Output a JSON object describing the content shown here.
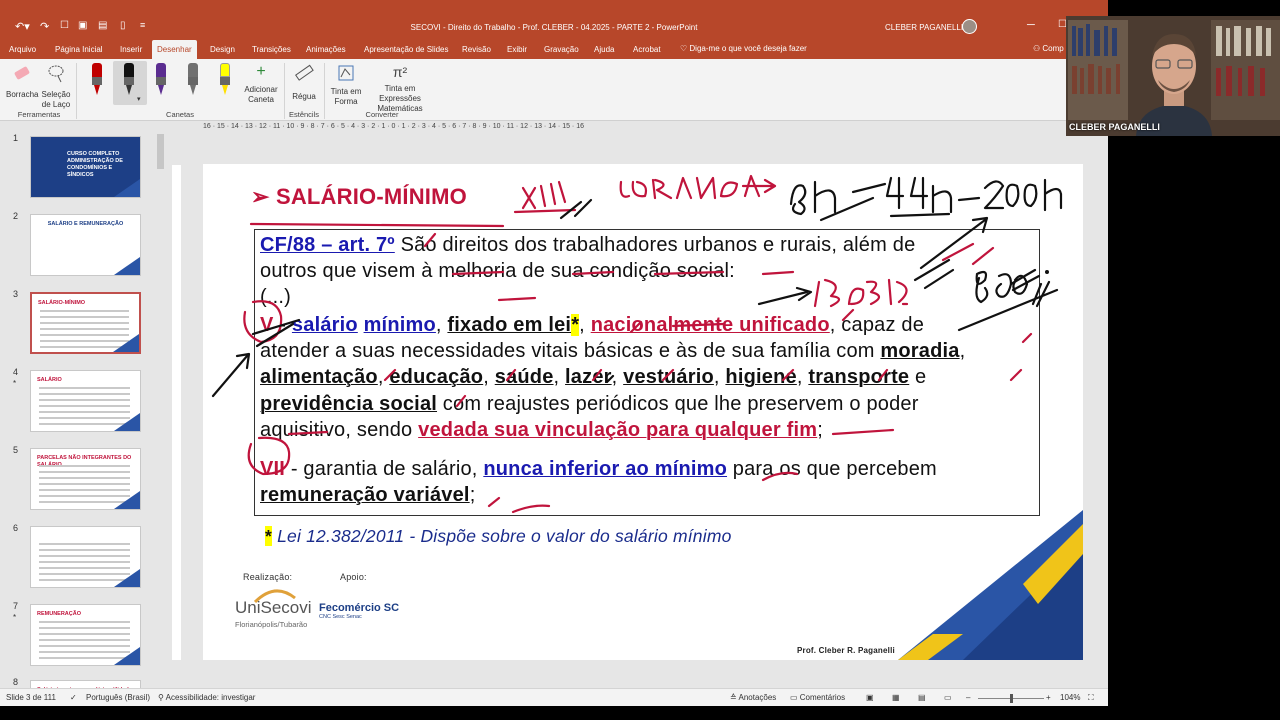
{
  "window": {
    "title": "SECOVI - Direito do Trabalho - Prof. CLEBER - 04.2025 - PARTE 2 - PowerPoint",
    "user": "CLEBER PAGANELLI"
  },
  "tabs": [
    "Arquivo",
    "Página Inicial",
    "Inserir",
    "Desenhar",
    "Design",
    "Transições",
    "Animações",
    "Apresentação de Slides",
    "Revisão",
    "Exibir",
    "Gravação",
    "Ajuda",
    "Acrobat"
  ],
  "active_tab": "Desenhar",
  "tell_me": "Diga-me o que você deseja fazer",
  "share": "Comp",
  "ribbon": {
    "eraser": "Borracha",
    "lasso": "Seleção de Laço",
    "add_pen": "Adicionar Caneta",
    "ruler": "Régua",
    "ink_to_shape": "Tinta em Forma",
    "ink_to_math": "Tinta em Expressões Matemáticas",
    "groups": {
      "tools": "Ferramentas",
      "pens": "Canetas",
      "stencils": "Estêncils",
      "convert": "Converter"
    },
    "pen_colors": [
      "#c00000",
      "#111111",
      "#5b2d90",
      "#707070",
      "#ffff00"
    ]
  },
  "thumbnails": [
    {
      "num": "1",
      "star": "",
      "title": "CURSO COMPLETO ADMINISTRAÇÃO DE CONDOMÍNIOS E SÍNDICOS"
    },
    {
      "num": "2",
      "star": "",
      "title": "SALÁRIO E REMUNERAÇÃO"
    },
    {
      "num": "3",
      "star": "",
      "title": "SALÁRIO-MÍNIMO"
    },
    {
      "num": "4",
      "star": "*",
      "title": "SALÁRIO"
    },
    {
      "num": "5",
      "star": "",
      "title": "PARCELAS NÃO INTEGRANTES DO SALÁRIO"
    },
    {
      "num": "6",
      "star": "",
      "title": ""
    },
    {
      "num": "7",
      "star": "*",
      "title": "REMUNERAÇÃO"
    },
    {
      "num": "8",
      "star": "",
      "title": "Salário in natura ou salário utilidade"
    }
  ],
  "ruler_labels": "16 · 15 · 14 · 13 · 12 · 11 · 10 · 9 · 8 · 7 · 6 · 5 · 4 · 3 · 2 · 1 · 0 · 1 · 2 · 3 · 4 · 5 · 6 · 7 · 8 · 9 · 10 · 11 · 12 · 13 · 14 · 15 · 16",
  "slide": {
    "heading_arrow": "➢",
    "heading": "SALÁRIO-MÍNIMO",
    "cf_ref": "CF/88 – art. 7º",
    "intro_1": " São direitos dos trabalhadores urbanos e rurais, além de",
    "intro_2": "outros que visem à melhoria de sua condição social:",
    "ellipsis": "(...)",
    "v_numeral": "V",
    "v_dash": " - ",
    "v_salario": "salário",
    "v_minimo": "mínimo",
    "v_fixado": "fixado em lei",
    "v_asterisk": "*",
    "v_nacional": "nacionalmente unificado",
    "v_capaz": ", capaz de",
    "line_atender": "atender a suas necessidades vitais básicas e às de sua família com",
    "moradia": "moradia",
    "alimentacao": "alimentação",
    "educacao": "educação",
    "saude": "saúde",
    "lazer": "lazer",
    "vestuario": "vestuário",
    "higiene": "higiene",
    "transporte": "transporte",
    "e": "e",
    "previdencia": "previdência social",
    "com_reajustes": "com reajustes periódicos que lhe preservem o poder",
    "aquisitivo": "aquisitivo, sendo",
    "vedada": "vedada sua vinculação para qualquer fim",
    "semicolon": ";",
    "vii_numeral": "VII",
    "vii_text": " - garantia de salário,",
    "vii_nunca": "nunca inferior ao mínimo",
    "vii_rest": " para os que percebem",
    "remuneracao": "remuneração variável",
    "footnote_star": "*",
    "footnote": " Lei 12.382/2011 - Dispõe sobre o valor do salário mínimo",
    "realizacao": "Realização:",
    "apoio": "Apoio:",
    "logo_unisecovi": "UniSecovi",
    "logo_unisecovi_sub": "Florianópolis/Tubarão",
    "logo_fecomercio": "Fecomércio SC",
    "logo_fecomercio_sub": "CNC Sesc Senac",
    "professor": "Prof. Cleber R. Paganelli"
  },
  "status": {
    "slide_of": "Slide 3 de 111",
    "language": "Português (Brasil)",
    "accessibility": "Acessibilidade: investigar",
    "notes": "Anotações",
    "comments": "Comentários",
    "zoom": "104%"
  },
  "webcam": {
    "name": "CLEBER PAGANELLI"
  }
}
